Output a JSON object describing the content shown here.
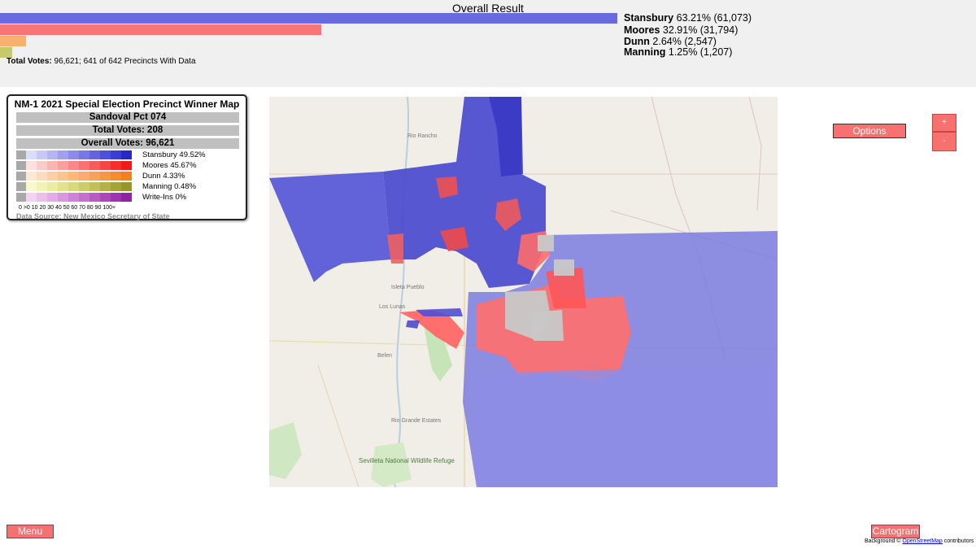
{
  "header": {
    "title": "Overall Result",
    "total_votes_label": "Total Votes:",
    "total_votes_text": " 96,621; 641 of 642 Precincts With Data"
  },
  "results": [
    {
      "name": "Stansbury",
      "detail": " 63.21% (61,073)",
      "percent": 63.21,
      "color": "#6a6ae0"
    },
    {
      "name": "Moores",
      "detail": " 32.91% (31,794)",
      "percent": 32.91,
      "color": "#f87575"
    },
    {
      "name": "Dunn",
      "detail": " 2.64% (2,547)",
      "percent": 2.64,
      "color": "#f7b070"
    },
    {
      "name": "Manning",
      "detail": " 1.25% (1,207)",
      "percent": 1.25,
      "color": "#c9c96a"
    }
  ],
  "legend": {
    "title": "NM-1 2021 Special Election Precinct Winner Map",
    "precinct": "Sandoval Pct 074",
    "precinct_votes": "Total Votes: 208",
    "overall_votes": "Overall Votes: 96,621",
    "rows": [
      {
        "label": "Stansbury 49.52%",
        "ramp": [
          "#dcdcfb",
          "#c8c8f7",
          "#b4b4f3",
          "#a0a0ee",
          "#8c8ce8",
          "#7878e2",
          "#6464dc",
          "#5050d6",
          "#3c3cce",
          "#2828c4"
        ]
      },
      {
        "label": "Moores 45.67%",
        "ramp": [
          "#fde0e0",
          "#fccaca",
          "#fbb4b4",
          "#fa9e9e",
          "#f98888",
          "#f87272",
          "#f65c5c",
          "#f44646",
          "#f23030",
          "#ef1a1a"
        ]
      },
      {
        "label": "Dunn 4.33%",
        "ramp": [
          "#fde8d4",
          "#fcdcbc",
          "#fbd0a6",
          "#fac590",
          "#f9ba7a",
          "#f8ae66",
          "#f7a352",
          "#f6983e",
          "#f48d2a",
          "#f28218"
        ]
      },
      {
        "label": "Manning 0.48%",
        "ramp": [
          "#f8f8cc",
          "#f2f2b8",
          "#ececa4",
          "#e2e290",
          "#d8d87e",
          "#cccc6c",
          "#c0c05a",
          "#b2b24a",
          "#a4a43a",
          "#96962a"
        ]
      },
      {
        "label": "Write-Ins 0%",
        "ramp": [
          "#f2d4f2",
          "#eac0ea",
          "#e2acea",
          "#d898e0",
          "#ce84d6",
          "#c470cc",
          "#b85cc2",
          "#ac48b8",
          "#a034ae",
          "#9420a4"
        ]
      }
    ],
    "scale_ticks": "0  >0  10  20  30  40  50  60  70  80  90  100+",
    "data_source": "Data Source: New Mexico Secretary of State"
  },
  "map": {
    "place_labels": [
      "Rio Rancho",
      "Isleta Pueblo",
      "Los Lunas",
      "Belen",
      "Sevilleta National Wildlife Refuge",
      "Rio Grande Estates"
    ]
  },
  "controls": {
    "options_label": "Options",
    "zoom_in": "+",
    "zoom_out": "-",
    "menu_label": "Menu",
    "cartogram_label": "Cartogram"
  },
  "attribution": {
    "prefix": "Background © ",
    "link": "OpenStreetMap",
    "suffix": " contributors"
  }
}
